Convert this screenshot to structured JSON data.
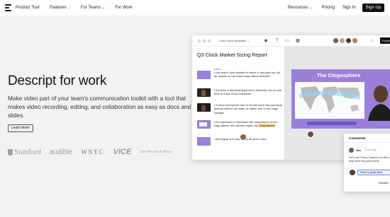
{
  "nav": {
    "items": [
      {
        "label": "Product Tour",
        "dropdown": false
      },
      {
        "label": "Features",
        "dropdown": true
      },
      {
        "label": "For Teams",
        "dropdown": true
      },
      {
        "label": "For Work",
        "dropdown": false
      }
    ],
    "right": {
      "resources": "Resources",
      "pricing": "Pricing",
      "sign_in": "Sign In",
      "sign_up": "Sign Up"
    }
  },
  "hero": {
    "title": "Descript for work",
    "subtitle": "Make video part of your team's communication toolkit with a tool that makes video recording, editing, and collaboration as easy as docs and slides.",
    "cta": "Learn more"
  },
  "customer_logos": [
    {
      "name": "stanford-logo",
      "text": "Stanford"
    },
    {
      "name": "audible-logo",
      "text": "audible"
    },
    {
      "name": "wnyc-logo",
      "text": "WNYC"
    },
    {
      "name": "vice-logo",
      "text": "VICE"
    },
    {
      "name": "nyt-logo",
      "text": "The New York Times"
    }
  ],
  "app": {
    "project_select": "Click Clock Industries",
    "export_label": "Export",
    "doc_title": "Q3 Clock Market Sizing Report",
    "speaker": "Dave",
    "transcript": [
      "I hey team! I just wanted to check in and give you all an update on our latest clog market research.",
      "I It's been a fascinating period of discovery for us over here at Click-Clock Industries.",
      "I It turns out that the rise of remote work has put some serious wind in our sails, or rather, feet in our clogs hahaha.",
      "I It's important to remember the cornerstone of the clog market. We call this region the ",
      "I the region of ",
      "Clogosphere",
      "I the region of it only nearly all year round."
    ],
    "highlight_word": "Clogosphere",
    "slide_title": "The Clogosphere",
    "comments": {
      "header": "Comments",
      "author": "Jim",
      "time": "3 min ago",
      "text": "Let's use Fancy Captions for this to help drive the point home.",
      "reply": "That's a great idea!",
      "discard": "Discard"
    }
  },
  "colors": {
    "accent_purple": "#9a80d9",
    "speaker_purple": "#7b4be0",
    "highlight": "#ffd98a",
    "dark": "#111111"
  }
}
